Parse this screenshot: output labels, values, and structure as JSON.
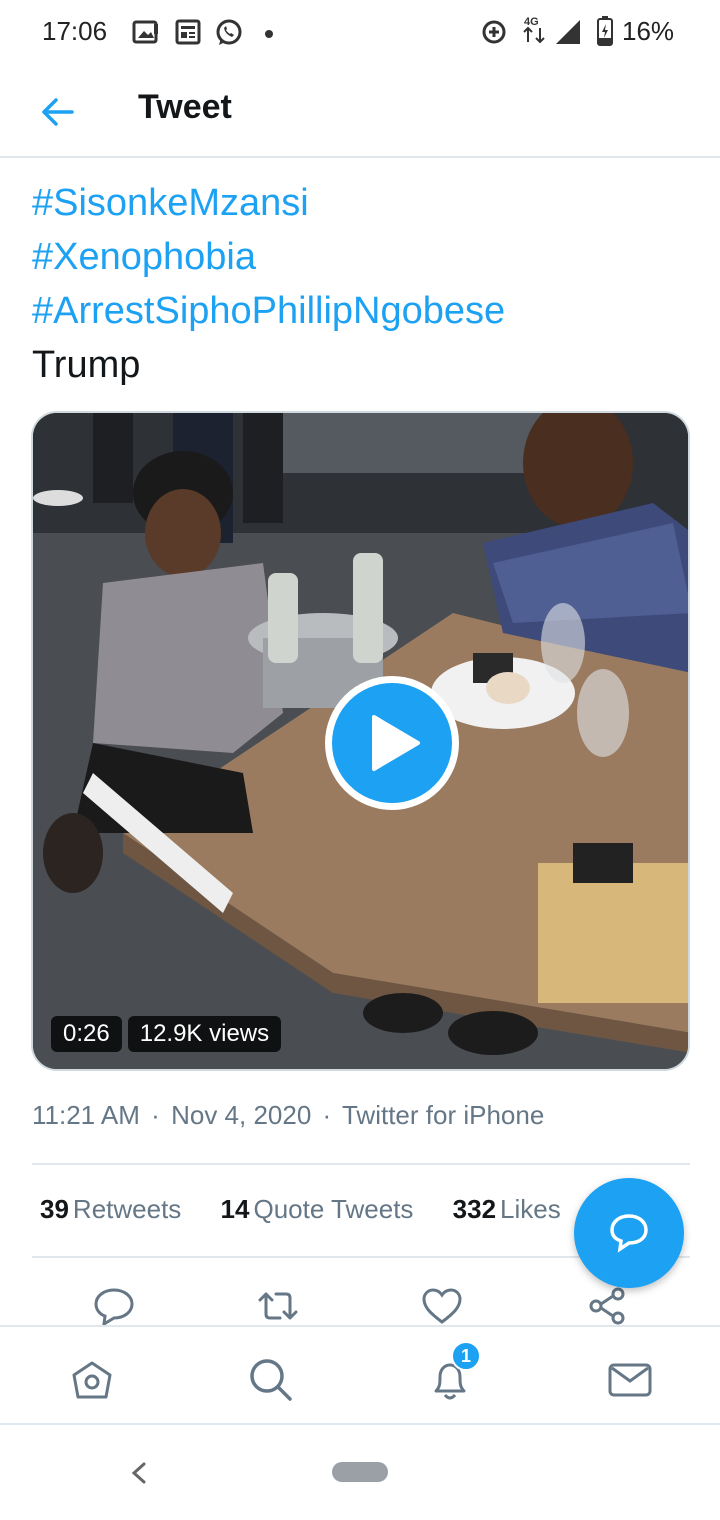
{
  "status_bar": {
    "time": "17:06",
    "network": "4G",
    "battery": "16%"
  },
  "header": {
    "title": "Tweet"
  },
  "tweet": {
    "hashtags": [
      "#SisonkeMzansi",
      "#Xenophobia",
      "#ArrestSiphoPhillipNgobese"
    ],
    "text": "Trump",
    "video": {
      "duration": "0:26",
      "views": "12.9K views"
    },
    "meta": {
      "time": "11:21 AM",
      "separator": "·",
      "date": "Nov 4, 2020",
      "source": "Twitter for iPhone"
    },
    "stats": {
      "retweets_count": "39",
      "retweets_label": "Retweets",
      "quotes_count": "14",
      "quotes_label": "Quote Tweets",
      "likes_count": "332",
      "likes_label": "Likes"
    }
  },
  "bottom_nav": {
    "notifications_badge": "1"
  },
  "colors": {
    "accent": "#1da1f2",
    "text_primary": "#14171a",
    "text_secondary": "#657786",
    "divider": "#e1e8ed"
  },
  "icons": {
    "status": [
      "gallery-icon",
      "news-icon",
      "whatsapp-icon",
      "dot-icon",
      "data-saver-icon",
      "signal-icon",
      "battery-icon"
    ],
    "actions": [
      "reply-icon",
      "retweet-icon",
      "like-icon",
      "share-icon"
    ],
    "nav": [
      "home-icon",
      "search-icon",
      "bell-icon",
      "mail-icon"
    ]
  }
}
